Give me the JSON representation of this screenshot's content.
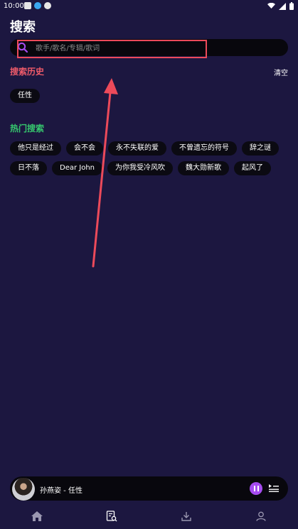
{
  "status_bar": {
    "time": "10:00"
  },
  "page": {
    "title": "搜索"
  },
  "search": {
    "placeholder": "歌手/歌名/专辑/歌词",
    "value": ""
  },
  "history": {
    "title": "搜索历史",
    "clear_label": "清空",
    "items": [
      "任性"
    ]
  },
  "hot": {
    "title": "热门搜索",
    "items": [
      "他只是经过",
      "会不会",
      "永不失联的爱",
      "不曾遗忘的符号",
      "辞之谜",
      "日不落",
      "Dear John",
      "为你我受冷风吹",
      "魏大勋新歌",
      "起风了"
    ]
  },
  "player": {
    "track": "孙燕姿 - 任性",
    "state": "playing"
  },
  "nav": {
    "items": [
      "home-icon",
      "search-list-icon",
      "download-icon",
      "user-icon"
    ],
    "active_index": 1
  },
  "colors": {
    "background": "#1c1740",
    "history_title": "#ef5b6a",
    "hot_title": "#36c86e",
    "accent_purple": "#a64cf0",
    "annotation_red": "#ec4a5a"
  }
}
